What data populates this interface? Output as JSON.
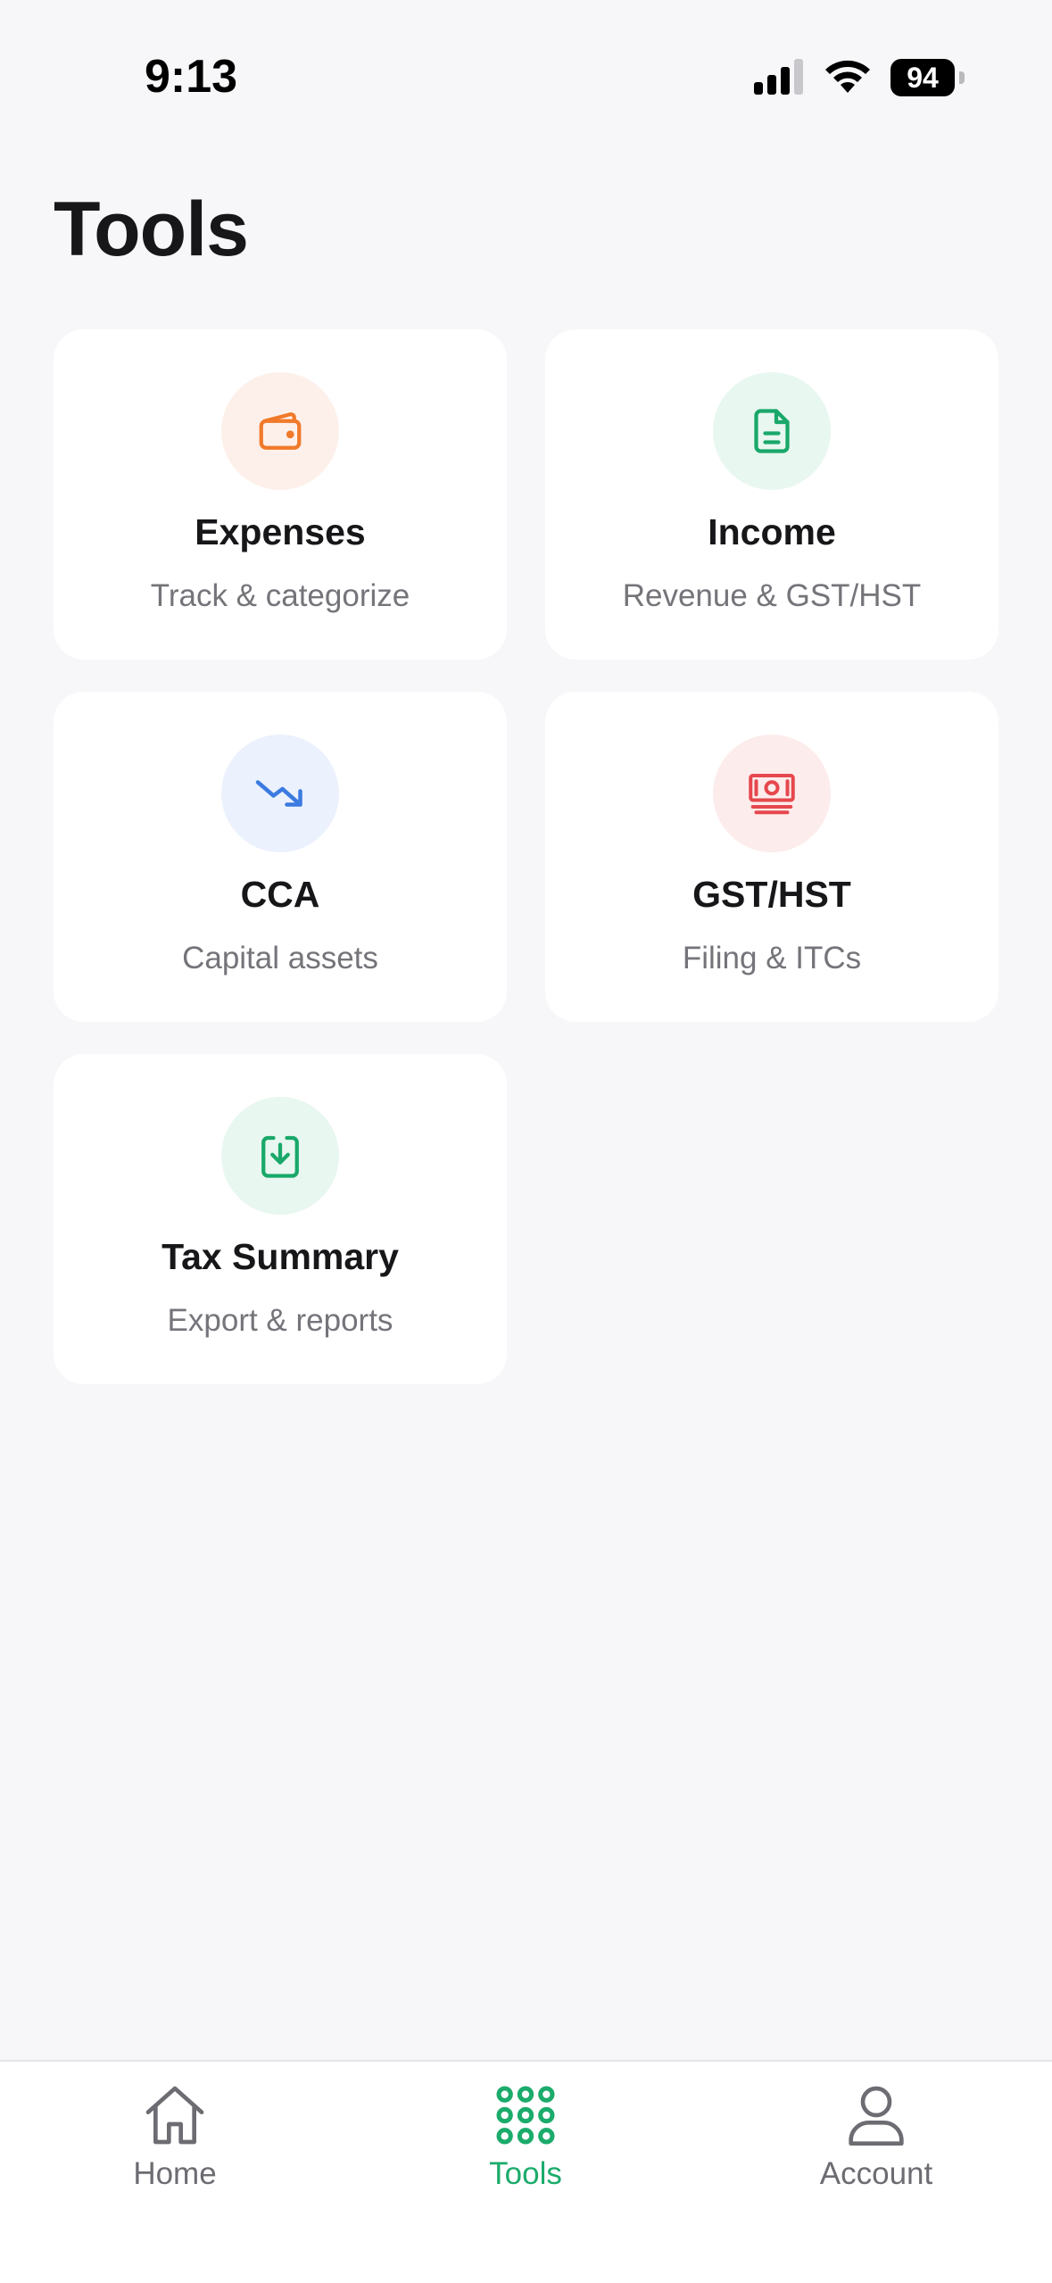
{
  "status_bar": {
    "time": "9:13",
    "battery": "94"
  },
  "page": {
    "title": "Tools"
  },
  "tools": [
    {
      "title": "Expenses",
      "subtitle": "Track & categorize",
      "icon": "wallet-icon",
      "color": "#f07a2a"
    },
    {
      "title": "Income",
      "subtitle": "Revenue & GST/HST",
      "icon": "document-icon",
      "color": "#19a86a"
    },
    {
      "title": "CCA",
      "subtitle": "Capital assets",
      "icon": "trending-down-icon",
      "color": "#3b7be0"
    },
    {
      "title": "GST/HST",
      "subtitle": "Filing & ITCs",
      "icon": "banknote-icon",
      "color": "#e5484d"
    },
    {
      "title": "Tax Summary",
      "subtitle": "Export & reports",
      "icon": "download-icon",
      "color": "#19a86a"
    }
  ],
  "tab_bar": {
    "items": [
      {
        "label": "Home",
        "icon": "home-icon",
        "active": false
      },
      {
        "label": "Tools",
        "icon": "grid-icon",
        "active": true
      },
      {
        "label": "Account",
        "icon": "person-icon",
        "active": false
      }
    ],
    "active_color": "#1bab6b",
    "inactive_color": "#6c6c72"
  }
}
